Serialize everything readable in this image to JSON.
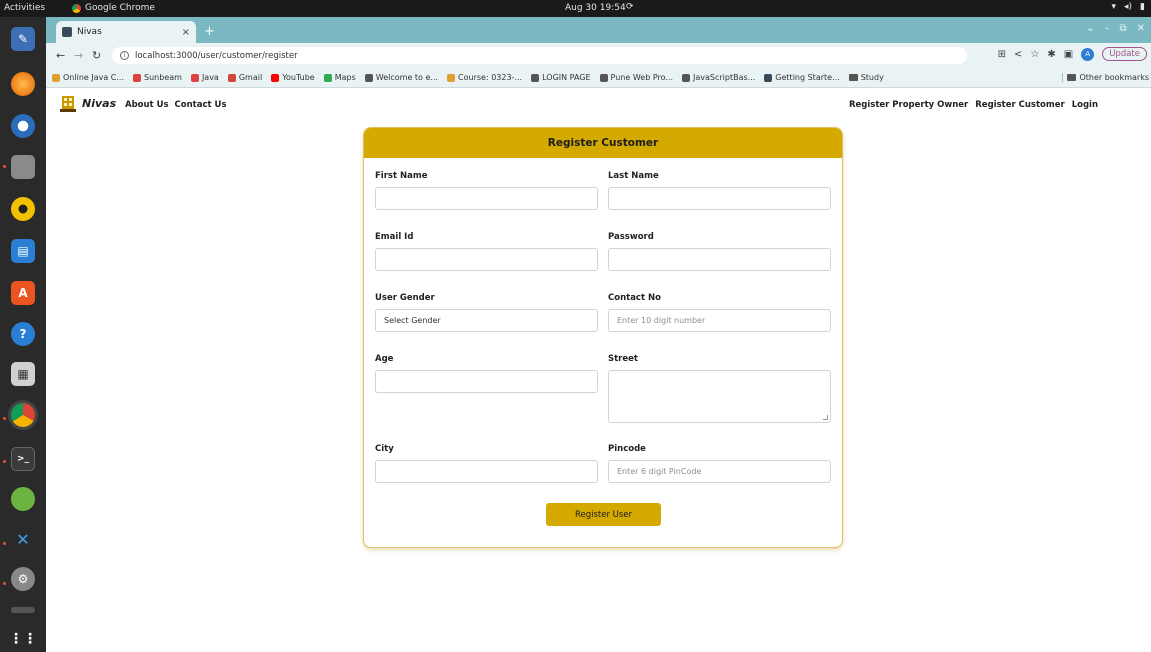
{
  "os_bar": {
    "activities": "Activities",
    "app_name": "Google Chrome",
    "clock": "Aug 30 19:54"
  },
  "browser": {
    "tab_title": "Nivas",
    "tab_close": "×",
    "new_tab": "+",
    "url": "localhost:3000/user/customer/register",
    "update_label": "Update",
    "avatar_letter": "A",
    "bookmarks": [
      {
        "label": "Online Java C...",
        "color": "#e0a030"
      },
      {
        "label": "Sunbeam",
        "color": "#e04040"
      },
      {
        "label": "Java",
        "color": "#e04040"
      },
      {
        "label": "Gmail",
        "color": "#d44638"
      },
      {
        "label": "YouTube",
        "color": "#ff0000"
      },
      {
        "label": "Maps",
        "color": "#34a853"
      },
      {
        "label": "Welcome to e...",
        "color": "#555555"
      },
      {
        "label": "Course: 0323-...",
        "color": "#e0a030"
      },
      {
        "label": "LOGIN PAGE",
        "color": "#555555"
      },
      {
        "label": "Pune Web Pro...",
        "color": "#555555"
      },
      {
        "label": "JavaScriptBas...",
        "color": "#555555"
      },
      {
        "label": "Getting Starte...",
        "color": "#3a4a5a"
      },
      {
        "label": "Study",
        "color": "#555555"
      }
    ],
    "other_bookmarks": "Other bookmarks"
  },
  "navbar": {
    "brand": "Nivas",
    "left_links": [
      "About Us",
      "Contact Us"
    ],
    "right_links": [
      "Register Property Owner",
      "Register Customer",
      "Login"
    ]
  },
  "form": {
    "title": "Register Customer",
    "first_name_label": "First Name",
    "last_name_label": "Last Name",
    "email_label": "Email Id",
    "password_label": "Password",
    "gender_label": "User Gender",
    "gender_value": "Select Gender",
    "contact_label": "Contact No",
    "contact_placeholder": "Enter 10 digit number",
    "age_label": "Age",
    "street_label": "Street",
    "city_label": "City",
    "pincode_label": "Pincode",
    "pincode_placeholder": "Enter 6 digit PinCode",
    "submit_label": "Register User"
  },
  "colors": {
    "accent": "#d4a900",
    "chrome_frame": "#7ab8c2"
  }
}
